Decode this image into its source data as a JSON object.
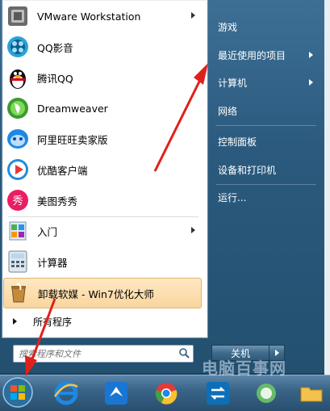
{
  "programs": [
    {
      "label": "VMware Workstation",
      "icon": "vmware-icon",
      "has_submenu": true
    },
    {
      "label": "QQ影音",
      "icon": "qq-player-icon",
      "has_submenu": false
    },
    {
      "label": "腾讯QQ",
      "icon": "qq-penguin-icon",
      "has_submenu": false
    },
    {
      "label": "Dreamweaver",
      "icon": "dreamweaver-icon",
      "has_submenu": false
    },
    {
      "label": "阿里旺旺卖家版",
      "icon": "aliwangwang-icon",
      "has_submenu": false
    },
    {
      "label": "优酷客户端",
      "icon": "youku-icon",
      "has_submenu": false
    },
    {
      "label": "美图秀秀",
      "icon": "meitu-icon",
      "has_submenu": false
    },
    {
      "label": "入门",
      "icon": "getting-started-icon",
      "has_submenu": true
    },
    {
      "label": "计算器",
      "icon": "calculator-icon",
      "has_submenu": false
    },
    {
      "label": "卸载软媒 - Win7优化大师",
      "icon": "uninstall-icon",
      "has_submenu": false
    }
  ],
  "meitu_glyph": "秀",
  "all_programs": "所有程序",
  "search_placeholder": "搜索程序和文件",
  "right_items": [
    {
      "label": "游戏",
      "has_submenu": false
    },
    {
      "label": "最近使用的项目",
      "has_submenu": true
    },
    {
      "label": "计算机",
      "has_submenu": true
    },
    {
      "label": "网络",
      "has_submenu": false
    },
    {
      "label": "控制面板",
      "has_submenu": false
    },
    {
      "label": "设备和打印机",
      "has_submenu": false
    },
    {
      "label": "运行...",
      "has_submenu": false
    }
  ],
  "shutdown_label": "关机",
  "watermark": "电脑百事网",
  "colors": {
    "highlight": "#fbd59d",
    "annotation": "#e0201a",
    "menu_blue": "#2b5a7e"
  }
}
